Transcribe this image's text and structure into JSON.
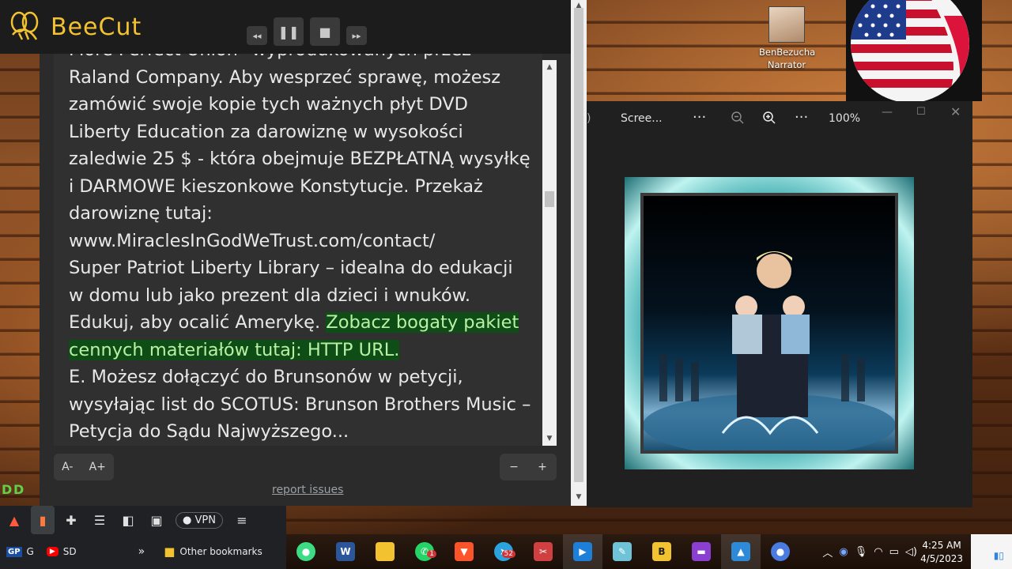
{
  "app": {
    "name": "BeeCut",
    "brand_color": "#f2c230"
  },
  "media_controls": [
    "rewind-icon",
    "pause-icon",
    "stop-icon",
    "fast-forward-icon"
  ],
  "reader": {
    "lines": [
      "More Perfect Union” wyprodukowanych przez",
      "Raland Company. Aby wesprzeć sprawę, możesz",
      "zamówić swoje kopie tych ważnych płyt DVD",
      "Liberty Education za darowiznę w wysokości",
      "zaledwie 25 $ - która obejmuje BEZPŁATNĄ wysyłkę",
      "i DARMOWE kieszonkowe Konstytucje. Przekaż",
      "darowiznę tutaj:",
      "www.MiraclesInGodWeTrust.com/contact/",
      "Super Patriot Liberty Library – idealna do edukacji",
      "w domu lub jako prezent dla dzieci i wnuków."
    ],
    "line11_plain": "Edukuj, aby ocalić Amerykę. ",
    "line11_highlight": "Zobacz bogaty pakiet",
    "line12_highlight": "cennych materiałów tutaj: HTTP URL.",
    "tail_lines": [
      "E. Możesz dołączyć do Brunsonów w petycji,",
      "wysyłając list do SCOTUS: Brunson Brothers Music –",
      "Petycja do Sądu Najwyższego..."
    ],
    "font_minus": "A-",
    "font_plus": "A+",
    "zoom_minus": "−",
    "zoom_plus": "+",
    "report_link": "report issues",
    "highlight_color": "#0f4d16"
  },
  "desktop_icon": {
    "line1": "BenBezucha",
    "line2": "Narrator"
  },
  "photo_viewer": {
    "title": "Scree...",
    "more1": "···",
    "zoom_out": "zoom-out-icon",
    "zoom_in": "zoom-in-icon",
    "more2": "···",
    "zoom_level": "100%"
  },
  "browser": {
    "vpn_label": "VPN",
    "bookmarks": [
      {
        "icon": "gp-icon",
        "label": "G"
      },
      {
        "icon": "youtube-icon",
        "label": "SD"
      }
    ],
    "more": "»",
    "other_bookmarks": "Other bookmarks"
  },
  "taskbar": {
    "time": "4:25 AM",
    "date": "4/5/2023",
    "telegram_badge": "52",
    "whatsapp_badge": "1"
  }
}
